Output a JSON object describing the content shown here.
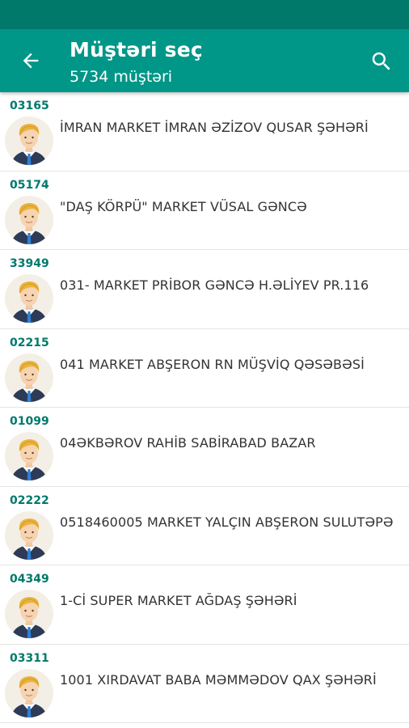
{
  "header": {
    "title": "Müştəri seç",
    "subtitle": "5734 müştəri",
    "back_icon": "arrow-back-icon",
    "search_icon": "search-icon"
  },
  "colors": {
    "status_bar": "#00796b",
    "app_bar": "#009688",
    "code_text": "#00796b"
  },
  "customers": [
    {
      "code": "03165",
      "name": "İMRAN MARKET İMRAN ƏZİZOV QUSAR ŞƏHƏRİ"
    },
    {
      "code": "05174",
      "name": "\"DAŞ KÖRPÜ\" MARKET VÜSAL GƏNCƏ"
    },
    {
      "code": "33949",
      "name": "031- MARKET PRİBOR GƏNCƏ H.ƏLİYEV PR.116"
    },
    {
      "code": "02215",
      "name": "041 MARKET ABŞERON RN MÜŞVİQ QƏSƏBƏSİ"
    },
    {
      "code": "01099",
      "name": "04ƏKBƏROV RAHİB SABİRABAD BAZAR"
    },
    {
      "code": "02222",
      "name": "0518460005 MARKET YALÇIN ABŞERON SULUTƏPƏ"
    },
    {
      "code": "04349",
      "name": "1-Cİ SUPER MARKET AĞDAŞ ŞƏHƏRİ"
    },
    {
      "code": "03311",
      "name": "1001 XIRDAVAT BABA MƏMMƏDOV QAX ŞƏHƏRİ"
    }
  ]
}
